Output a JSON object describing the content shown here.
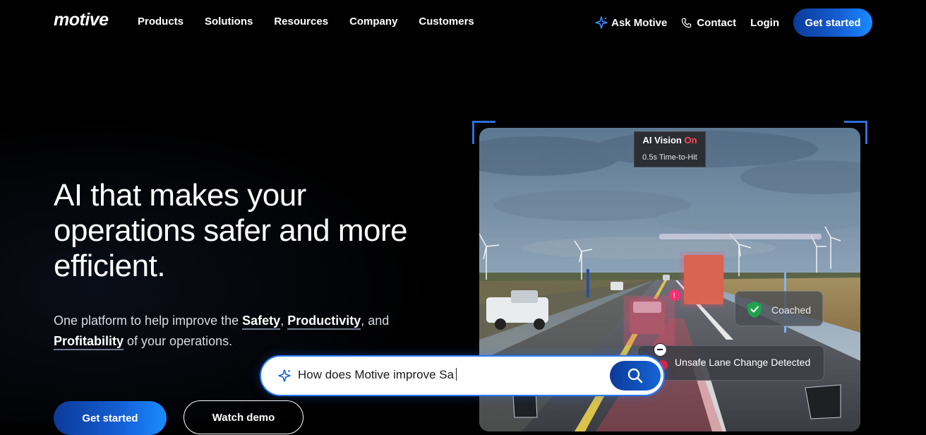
{
  "brand": {
    "logo_text": "motive",
    "accent_color": "#1565d8"
  },
  "nav": {
    "links": [
      "Products",
      "Solutions",
      "Resources",
      "Company",
      "Customers"
    ],
    "ask_label": "Ask Motive",
    "contact_label": "Contact",
    "login_label": "Login",
    "cta_label": "Get started"
  },
  "hero": {
    "title": "AI that makes your operations safer and more efficient.",
    "subtitle_prefix": "One platform to help improve the",
    "highlight_safety": "Safety",
    "highlight_productivity": "Productivity",
    "and_text": "and",
    "highlight_profitability": "Profitability",
    "subtitle_suffix": "of your operations.",
    "primary_cta": "Get started",
    "secondary_cta": "Watch demo"
  },
  "video_overlay": {
    "ai_vision_label": "AI Vision",
    "ai_vision_status": "On",
    "time_to_hit": "0.5s  Time-to-Hit",
    "coached_label": "Coached",
    "alert_label": "Unsafe Lane Change Detected"
  },
  "search": {
    "typed_text": "How does Motive improve Sa",
    "icon": "sparkle-icon",
    "button_icon": "search-icon"
  }
}
